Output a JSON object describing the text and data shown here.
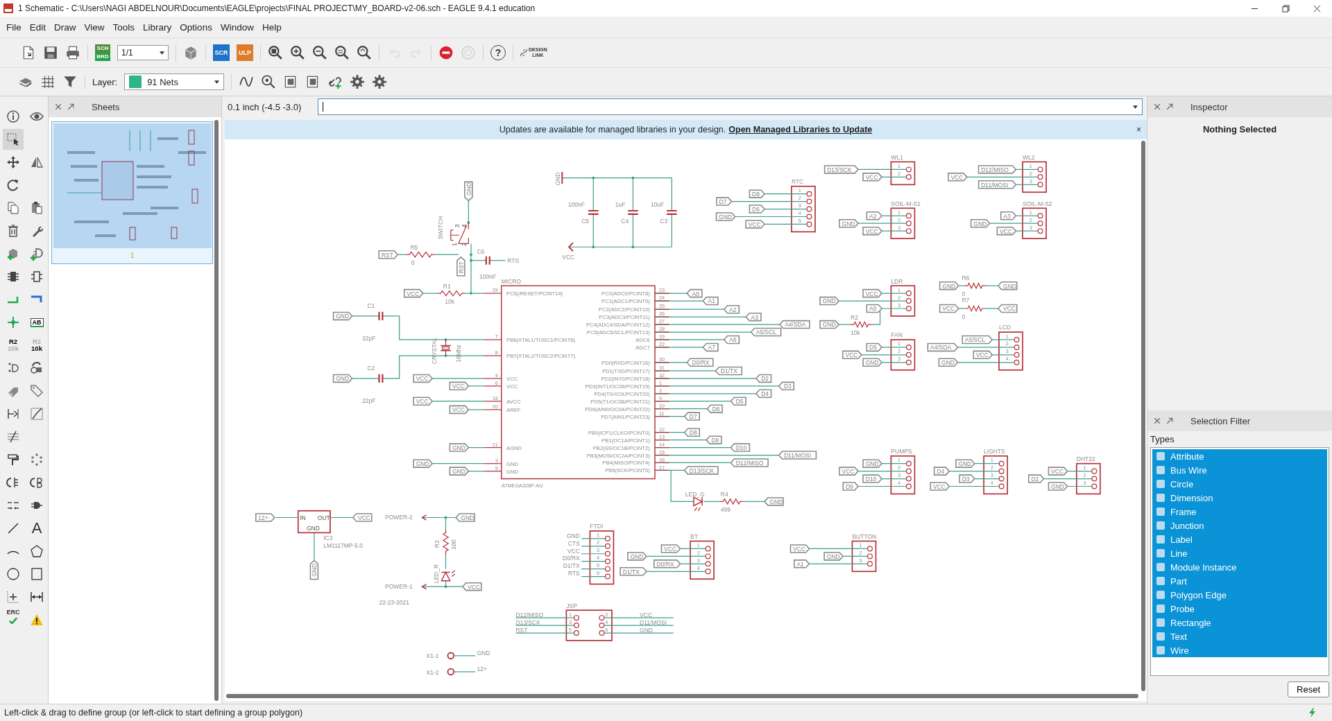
{
  "window": {
    "title": "1 Schematic - C:\\Users\\NAGI ABDELNOUR\\Documents\\EAGLE\\projects\\FINAL PROJECT\\MY_BOARD-v2-06.sch - EAGLE 9.4.1 education"
  },
  "menu": [
    "File",
    "Edit",
    "Draw",
    "View",
    "Tools",
    "Library",
    "Options",
    "Window",
    "Help"
  ],
  "toolbar": [
    [
      {
        "kind": "new",
        "disabled": false
      },
      {
        "kind": "save",
        "disabled": false
      },
      {
        "kind": "print",
        "disabled": false
      }
    ],
    [
      {
        "kind": "switch",
        "text": "SCH",
        "subtext": "BRD",
        "disabled": false
      },
      {
        "kind": "sheet",
        "value": "1/1",
        "disabled": false
      }
    ],
    [
      {
        "kind": "cube",
        "disabled": false
      }
    ],
    [
      {
        "kind": "script",
        "text": "SCR",
        "disabled": false
      },
      {
        "kind": "ulp",
        "text": "ULP",
        "disabled": false
      }
    ],
    [
      {
        "kind": "zoomfit",
        "disabled": false
      },
      {
        "kind": "zoomin",
        "disabled": false
      },
      {
        "kind": "zoomout",
        "disabled": false
      },
      {
        "kind": "zoomselect",
        "disabled": false
      },
      {
        "kind": "zoomlast",
        "disabled": false
      }
    ],
    [
      {
        "kind": "undo",
        "disabled": true
      },
      {
        "kind": "redo",
        "disabled": true
      }
    ],
    [
      {
        "kind": "stop",
        "disabled": false
      },
      {
        "kind": "go",
        "disabled": true
      }
    ],
    [
      {
        "kind": "help",
        "text": "?",
        "disabled": false
      }
    ],
    [
      {
        "kind": "designlink",
        "text": "DESIGN",
        "subtext": "LINK",
        "disabled": false
      }
    ]
  ],
  "toolbar2": {
    "tools": [
      {
        "kind": "layers"
      },
      {
        "kind": "grid"
      },
      {
        "kind": "filter"
      }
    ],
    "layer_label": "Layer:",
    "layer_value": "91 Nets",
    "actions": [
      {
        "kind": "wire"
      },
      {
        "kind": "zoomsearch"
      },
      {
        "kind": "pages"
      },
      {
        "kind": "pages2"
      },
      {
        "kind": "linkadd"
      },
      {
        "kind": "gear"
      },
      {
        "kind": "gear"
      }
    ]
  },
  "tools": [
    [
      {
        "kind": "info",
        "selected": false
      },
      {
        "kind": "eye",
        "selected": false
      }
    ],
    [
      {
        "kind": "select",
        "selected": true
      }
    ],
    [
      {
        "kind": "move",
        "selected": false
      },
      {
        "kind": "mirror",
        "selected": false
      }
    ],
    [
      {
        "kind": "rotate",
        "selected": false
      }
    ],
    [
      {
        "kind": "copy",
        "selected": false
      },
      {
        "kind": "paste",
        "selected": false
      }
    ],
    [
      {
        "kind": "delete",
        "selected": false
      },
      {
        "kind": "wrench",
        "selected": false
      }
    ],
    [
      {
        "kind": "addpart",
        "selected": false
      },
      {
        "kind": "addgate",
        "selected": false
      }
    ],
    [
      {
        "kind": "chip",
        "selected": false
      },
      {
        "kind": "chipoutline",
        "selected": false
      }
    ],
    [
      {
        "kind": "net",
        "selected": false
      },
      {
        "kind": "bus",
        "selected": false
      }
    ],
    [
      {
        "kind": "junction",
        "selected": false
      },
      {
        "kind": "label",
        "text": "AB",
        "selected": false
      }
    ],
    [
      {
        "kind": "name",
        "text": "R2",
        "subtext": "10k",
        "selected": false
      },
      {
        "kind": "value",
        "text": "R2",
        "subtext": "10k",
        "selected": false
      }
    ],
    [
      {
        "kind": "invoke",
        "selected": false
      },
      {
        "kind": "replace",
        "selected": false
      }
    ],
    [
      {
        "kind": "package",
        "selected": false
      },
      {
        "kind": "tag",
        "selected": false
      }
    ],
    [
      {
        "kind": "pinswap",
        "selected": false
      },
      {
        "kind": "split",
        "selected": false
      }
    ],
    [
      {
        "kind": "slash",
        "selected": false
      }
    ],
    [
      {
        "kind": "paint",
        "selected": false
      },
      {
        "kind": "ripup",
        "selected": false
      }
    ],
    [
      {
        "kind": "swapa",
        "selected": false
      },
      {
        "kind": "swapb",
        "selected": false
      }
    ],
    [
      {
        "kind": "miter",
        "selected": false
      },
      {
        "kind": "gateswap",
        "selected": false
      }
    ],
    [
      {
        "kind": "line",
        "selected": false
      },
      {
        "kind": "text",
        "text": "A",
        "selected": false
      }
    ],
    [
      {
        "kind": "arc",
        "selected": false
      },
      {
        "kind": "polygon",
        "selected": false
      }
    ],
    [
      {
        "kind": "circle",
        "selected": false
      },
      {
        "kind": "rect",
        "selected": false
      }
    ],
    [
      {
        "kind": "mark",
        "selected": false
      },
      {
        "kind": "dimension",
        "selected": false
      }
    ],
    [
      {
        "kind": "erc",
        "text": "ERC",
        "selected": false
      },
      {
        "kind": "warning",
        "selected": false
      }
    ]
  ],
  "sheets_panel": {
    "title": "Sheets",
    "sheets": [
      {
        "number": "1",
        "selected": true
      }
    ]
  },
  "command_bar": {
    "coordinates": "0.1 inch (-4.5 -3.0)"
  },
  "banner": {
    "text": "Updates are available for managed libraries in your design.",
    "link": "Open Managed Libraries to Update",
    "close": "×"
  },
  "schematic": {
    "micro": {
      "name": "MICRO",
      "value": "ATMEGA328P-AU",
      "left_pins": [
        {
          "number": "29",
          "name": "PC6(/RESET/PCINT14)"
        },
        {
          "number": "7",
          "name": "PB6(XTAL1/TOSC1/PCINT6)"
        },
        {
          "number": "8",
          "name": "PB7(XTAL2/TOSC2/PCINT7)"
        },
        {
          "number": "4",
          "name": "VCC"
        },
        {
          "number": "6",
          "name": "VCC"
        },
        {
          "number": "18",
          "name": "AVCC"
        },
        {
          "number": "20",
          "name": "AREF"
        },
        {
          "number": "21",
          "name": "AGND"
        },
        {
          "number": "3",
          "name": "GND"
        },
        {
          "number": "5",
          "name": "GND"
        }
      ],
      "right_pins": [
        {
          "number": "23",
          "name": "PC0(ADC0/PCINT8)",
          "net": "A0"
        },
        {
          "number": "24",
          "name": "PC1(ADC1/PCINT9)",
          "net": "A1"
        },
        {
          "number": "25",
          "name": "PC2(ADC2/PCINT10)",
          "net": "A2"
        },
        {
          "number": "26",
          "name": "PC3(ADC3/PCINT11)",
          "net": "A3"
        },
        {
          "number": "27",
          "name": "PC4(ADC4/SDA/PCINT12)",
          "net": "A4/SDA"
        },
        {
          "number": "28",
          "name": "PC5(ADC5/SCL/PCINT13)",
          "net": "A5/SCL"
        },
        {
          "number": "19",
          "name": "ADC6",
          "net": "A6"
        },
        {
          "number": "22",
          "name": "ADC7",
          "net": "A7"
        },
        {
          "number": "30",
          "name": "PD0(RXD/PCINT16)",
          "net": "D0/RX"
        },
        {
          "number": "31",
          "name": "PD1(TXD/PCINT17)",
          "net": "D1/TX"
        },
        {
          "number": "32",
          "name": "PD2(INT0/PCINT18)",
          "net": "D2"
        },
        {
          "number": "1",
          "name": "PD3(INT1/OC2B/PCINT19)",
          "net": "D3"
        },
        {
          "number": "2",
          "name": "PD4(T0/XCK/PCINT20)",
          "net": "D4"
        },
        {
          "number": "9",
          "name": "PD5(T1/OC0B/PCINT21)",
          "net": "D5"
        },
        {
          "number": "10",
          "name": "PD6(AIN0/OC0A/PCINT22)",
          "net": "D6"
        },
        {
          "number": "11",
          "name": "PD7(AIN1/PCINT23)",
          "net": "D7"
        },
        {
          "number": "12",
          "name": "PB0(ICP1/CLKO/PCINT0)",
          "net": "D8"
        },
        {
          "number": "13",
          "name": "PB1(OC1A/PCINT1)",
          "net": "D9"
        },
        {
          "number": "14",
          "name": "PB2(SS/OC1B/PCINT2)",
          "net": "D10"
        },
        {
          "number": "15",
          "name": "PB3(MOSI/OC2A/PCINT3)",
          "net": "D11/MOSI"
        },
        {
          "number": "16",
          "name": "PB4(MISO/PCINT4)",
          "net": "D12/MISO"
        },
        {
          "number": "17",
          "name": "PB5(SCK/PCINT5)",
          "net": "D13/SCK"
        }
      ]
    },
    "headers": [
      {
        "name": "RTC",
        "kind": "flags",
        "pins": [
          {
            "number": "1",
            "net": "D8"
          },
          {
            "number": "2",
            "net": "D7"
          },
          {
            "number": "3",
            "net": "D6"
          },
          {
            "number": "4",
            "net": "GND"
          },
          {
            "number": "5",
            "net": "VCC"
          }
        ]
      },
      {
        "name": "WL1",
        "kind": "flags",
        "pins": [
          {
            "number": "1",
            "net": "D13/SCK"
          },
          {
            "number": "2",
            "net": "VCC"
          }
        ]
      },
      {
        "name": "WL2",
        "kind": "flags",
        "pins": [
          {
            "number": "1",
            "net": "D12/MISO"
          },
          {
            "number": "2",
            "net": "VCC"
          },
          {
            "number": "3",
            "net": "D11/MOSI"
          }
        ]
      },
      {
        "name": "SOIL-M-S1",
        "kind": "flags",
        "pins": [
          {
            "number": "1",
            "net": "A2"
          },
          {
            "number": "2",
            "net": "GND"
          },
          {
            "number": "3",
            "net": "VCC"
          }
        ]
      },
      {
        "name": "SOIL-M-S2",
        "kind": "flags",
        "pins": [
          {
            "number": "1",
            "net": "A3"
          },
          {
            "number": "2",
            "net": "GND"
          },
          {
            "number": "3",
            "net": "VCC"
          }
        ]
      },
      {
        "name": "LDR",
        "kind": "flags",
        "pins": [
          {
            "number": "1",
            "net": "VCC"
          },
          {
            "number": "2",
            "net": "GND"
          },
          {
            "number": "3",
            "net": "A0"
          }
        ]
      },
      {
        "name": "FAN",
        "kind": "flags",
        "pins": [
          {
            "number": "1",
            "net": "D5"
          },
          {
            "number": "2",
            "net": "VCC"
          },
          {
            "number": "3",
            "net": "GND"
          }
        ]
      },
      {
        "name": "LCD",
        "kind": "flags",
        "pins": [
          {
            "number": "1",
            "net": "A5/SCL"
          },
          {
            "number": "2",
            "net": "A4/SDA"
          },
          {
            "number": "3",
            "net": "VCC"
          },
          {
            "number": "4",
            "net": "GND"
          }
        ]
      },
      {
        "name": "PUMPS",
        "kind": "flags",
        "pins": [
          {
            "number": "1",
            "net": "GND"
          },
          {
            "number": "2",
            "net": "VCC"
          },
          {
            "number": "3",
            "net": "D10"
          },
          {
            "number": "4",
            "net": "D9"
          }
        ]
      },
      {
        "name": "LIGHTS",
        "kind": "flags",
        "pins": [
          {
            "number": "1",
            "net": "GND"
          },
          {
            "number": "2",
            "net": "D4"
          },
          {
            "number": "3",
            "net": "D3"
          },
          {
            "number": "4",
            "net": "VCC"
          }
        ]
      },
      {
        "name": "DHT22",
        "kind": "flags",
        "pins": [
          {
            "number": "1",
            "net": "VCC"
          },
          {
            "number": "2",
            "net": "D2"
          },
          {
            "number": "3",
            "net": "GND"
          }
        ]
      },
      {
        "name": "FTDI",
        "kind": "text",
        "pins": [
          {
            "number": "1",
            "net": "GND"
          },
          {
            "number": "2",
            "net": "CTS"
          },
          {
            "number": "3",
            "net": "VCC"
          },
          {
            "number": "4",
            "net": "D0/RX"
          },
          {
            "number": "5",
            "net": "D1/TX"
          },
          {
            "number": "6",
            "net": "RTS"
          }
        ]
      },
      {
        "name": "BT",
        "kind": "flags",
        "pins": [
          {
            "number": "1",
            "net": "VCC"
          },
          {
            "number": "2",
            "net": "GND"
          },
          {
            "number": "3",
            "net": "D0/RX"
          },
          {
            "number": "4",
            "net": "D1/TX"
          }
        ]
      },
      {
        "name": "BUTTON",
        "kind": "flags",
        "pins": [
          {
            "number": "1",
            "net": "VCC"
          },
          {
            "number": "2",
            "net": "GND"
          },
          {
            "number": "3",
            "net": "A1"
          }
        ]
      }
    ],
    "isp": {
      "name": "JSP",
      "left": [
        {
          "number": "1",
          "net": "D12/MISO"
        },
        {
          "number": "3",
          "net": "D13/SCK"
        },
        {
          "number": "5",
          "net": "RST"
        }
      ],
      "right": [
        {
          "number": "2",
          "net": "VCC"
        },
        {
          "number": "4",
          "net": "D11/MOSI"
        },
        {
          "number": "6",
          "net": "GND"
        }
      ]
    },
    "net_labels": [
      "VCC",
      "GND",
      "GND",
      "VCC",
      "VCC",
      "VCC",
      "VCC",
      "GND",
      "GND",
      "GND",
      "RST",
      "RST",
      "GND",
      "GND",
      "GND",
      "GND",
      "VCC",
      "VCC",
      "GND",
      "12+",
      "VCC",
      "GND",
      "GND",
      "VCC"
    ],
    "resistors": [
      {
        "name": "R1",
        "value": "10k"
      },
      {
        "name": "R5",
        "value": "0"
      },
      {
        "name": "R2",
        "value": "10k"
      },
      {
        "name": "R6",
        "value": "0"
      },
      {
        "name": "R7",
        "value": "0"
      },
      {
        "name": "R4",
        "value": "499"
      },
      {
        "name": "R3",
        "value": "100"
      }
    ],
    "capacitors": [
      {
        "name": "C5",
        "value": "100nF"
      },
      {
        "name": "C4",
        "value": "1uF"
      },
      {
        "name": "C3",
        "value": "10uF"
      },
      {
        "name": "C6",
        "value": "100nF"
      },
      {
        "name": "C1",
        "value": "22pF"
      },
      {
        "name": "C2",
        "value": "22pF"
      }
    ],
    "supplies": [
      {
        "name": "GND"
      },
      {
        "name": "VCC"
      }
    ],
    "switch": {
      "name": "SWITCH",
      "pins": [
        "1",
        "2",
        "3",
        "4"
      ]
    },
    "crystal": {
      "name": "CRYSTAL",
      "value": "16Mhz"
    },
    "leds": [
      {
        "name": "LED_G"
      },
      {
        "name": "LED_R"
      }
    ],
    "regulator": {
      "name": "IC3",
      "value": "LM1117MP-5.0",
      "pins": [
        "IN",
        "OUT",
        "GND"
      ]
    },
    "power_pins": [
      {
        "name": "POWER-2"
      },
      {
        "name": "POWER-1"
      }
    ],
    "terminals": [
      {
        "name": "X1-1",
        "net": "GND"
      },
      {
        "name": "X1-2",
        "net": "12+"
      }
    ],
    "texts": [
      "RTS",
      "22-23-2021"
    ]
  },
  "inspector": {
    "title": "Inspector",
    "message": "Nothing Selected"
  },
  "selection_filter": {
    "title": "Selection Filter",
    "heading": "Types",
    "types": [
      {
        "label": "Attribute",
        "selected": true
      },
      {
        "label": "Bus Wire",
        "selected": true
      },
      {
        "label": "Circle",
        "selected": true
      },
      {
        "label": "Dimension",
        "selected": true
      },
      {
        "label": "Frame",
        "selected": true
      },
      {
        "label": "Junction",
        "selected": true
      },
      {
        "label": "Label",
        "selected": true
      },
      {
        "label": "Line",
        "selected": true
      },
      {
        "label": "Module Instance",
        "selected": true
      },
      {
        "label": "Part",
        "selected": true
      },
      {
        "label": "Polygon Edge",
        "selected": true
      },
      {
        "label": "Probe",
        "selected": true
      },
      {
        "label": "Rectangle",
        "selected": true
      },
      {
        "label": "Text",
        "selected": true
      },
      {
        "label": "Wire",
        "selected": true
      }
    ],
    "reset": "Reset"
  },
  "status_bar": {
    "message": "Left-click & drag to define group (or left-click to start defining a group polygon)"
  }
}
